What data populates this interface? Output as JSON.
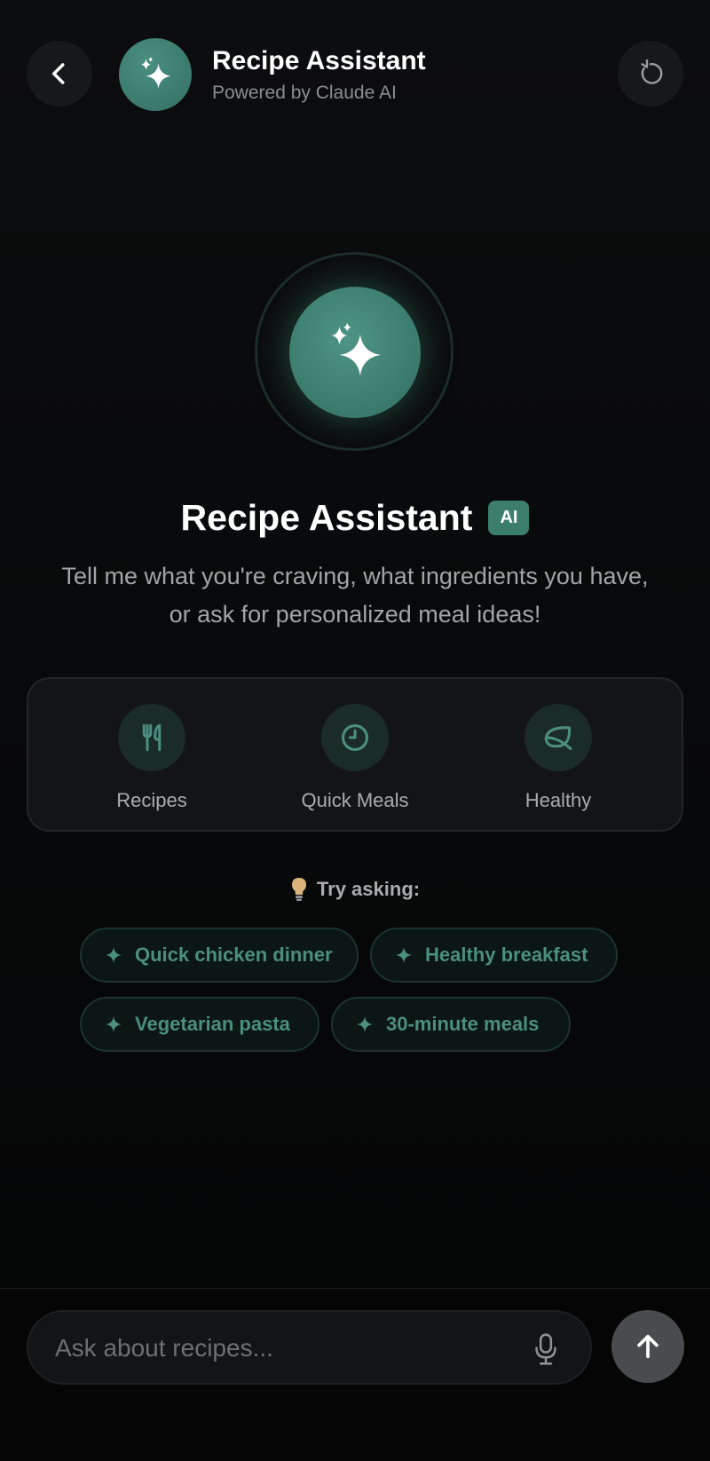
{
  "header": {
    "title": "Recipe Assistant",
    "subtitle": "Powered by Claude AI",
    "back_icon": "chevron-left-icon",
    "refresh_icon": "refresh-icon",
    "avatar_icon": "sparkles-icon"
  },
  "hero": {
    "icon": "sparkles-icon",
    "title": "Recipe Assistant",
    "badge": "AI",
    "description": "Tell me what you're craving, what ingredients you have, or ask for personalized meal ideas!"
  },
  "categories": [
    {
      "label": "Recipes",
      "icon": "utensils-icon"
    },
    {
      "label": "Quick Meals",
      "icon": "clock-icon"
    },
    {
      "label": "Healthy",
      "icon": "leaf-icon"
    }
  ],
  "suggestions": {
    "heading": "Try asking:",
    "heading_icon": "lightbulb-icon",
    "chips": [
      "Quick chicken dinner",
      "Healthy breakfast",
      "Vegetarian pasta",
      "30-minute meals"
    ]
  },
  "composer": {
    "placeholder": "Ask about recipes...",
    "value": "",
    "mic_icon": "microphone-icon",
    "send_icon": "arrow-up-icon"
  },
  "colors": {
    "accent": "#3c7d6c",
    "chip_text": "#4b8f7e",
    "background": "#0a0b0c",
    "card": "#131415",
    "send_button": "#4a4b4e"
  }
}
